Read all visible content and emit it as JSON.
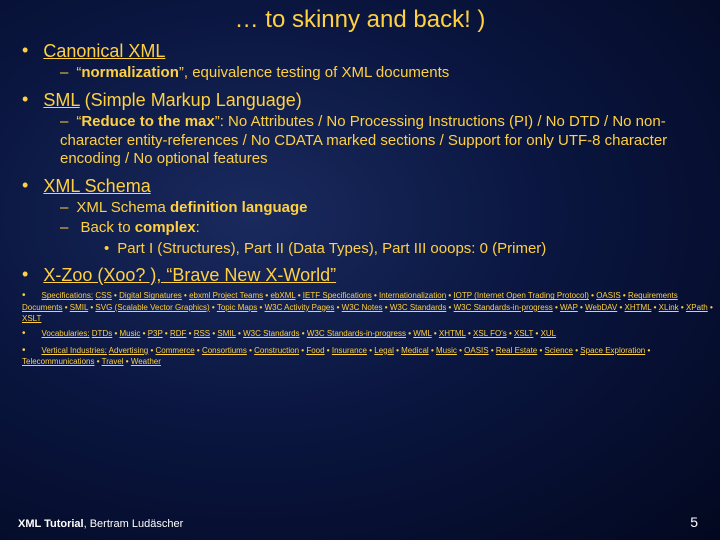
{
  "title": "… to skinny and back! )",
  "items": [
    {
      "label_link": "Canonical XML",
      "subs": [
        {
          "html": "“<b>normalization</b>”, equivalence testing of XML documents"
        }
      ]
    },
    {
      "label_link": "SML",
      "label_rest": " (Simple Markup Language)",
      "subs": [
        {
          "html": "“<b>Reduce to the max</b>”: No Attributes / No Processing Instructions (PI)  / No DTD / No non-character entity-references / No CDATA marked sections / Support for only UTF-8 character encoding / No optional features"
        }
      ]
    },
    {
      "label_link": "XML Schema",
      "subs": [
        {
          "html": "XML Schema <b>definition language</b>"
        },
        {
          "html": "Back to <b>complex</b>:",
          "sub3": [
            {
              "text": "Part I (Structures), Part II (Data Types), Part III ooops: 0 (Primer)"
            }
          ]
        }
      ]
    },
    {
      "label_text": "X-Zoo (Xoo? ), “Brave New X-World”"
    }
  ],
  "tiny": [
    {
      "lead": "Specifications:",
      "links": [
        "CSS",
        "Digital Signatures",
        "ebxml Project Teams",
        "ebXML",
        "IETF Specifications",
        "Internationalization",
        "IOTP (Internet Open Trading Protocol)",
        "OASIS",
        "Requirements Documents",
        "SMIL",
        "SVG (Scalable Vector Graphics)",
        "Topic Maps",
        "W3C Activity Pages",
        "W3C Notes",
        "W3C Standards",
        "W3C Standards-in-progress",
        "WAP",
        "WebDAV",
        "XHTML",
        "XLink",
        "XPath",
        "XSLT"
      ]
    },
    {
      "lead": "Vocabularies:",
      "links": [
        "DTDs",
        "Music",
        "P3P",
        "RDF",
        "RSS",
        "SMIL",
        "W3C Standards",
        "W3C Standards-in-progress",
        "WML",
        "XHTML",
        "XSL FO's",
        "XSLT",
        "XUL"
      ]
    },
    {
      "lead": "Vertical Industries:",
      "links": [
        "Advertising",
        "Commerce",
        "Consortiums",
        "Construction",
        "Food",
        "Insurance",
        "Legal",
        "Medical",
        "Music",
        "OASIS",
        "Real Estate",
        "Science",
        "Space Exploration",
        "Telecommunications",
        "Travel",
        "Weather"
      ]
    }
  ],
  "footer": {
    "title": "XML Tutorial",
    "author": ", Bertram Ludäscher"
  },
  "pagenum": "5"
}
